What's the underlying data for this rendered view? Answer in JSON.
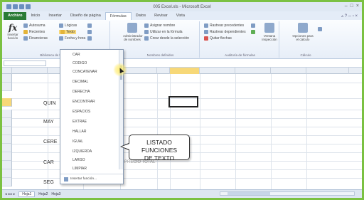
{
  "window": {
    "title": "005 Excel.xls - Microsoft Excel",
    "controls": [
      "–",
      "□",
      "×"
    ]
  },
  "ribbon": {
    "tabs": [
      "Archivo",
      "Inicio",
      "Insertar",
      "Diseño de página",
      "Fórmulas",
      "Datos",
      "Revisar",
      "Vista"
    ],
    "active_tab": "Fórmulas",
    "insert_function": "Insertar función",
    "library": {
      "autosum": "Autosuma",
      "recent": "Recientes",
      "financial": "Financieras",
      "logical": "Lógicas",
      "text": "Texto",
      "date_time": "Fecha y hora",
      "more": "Más funciones",
      "caption": "Biblioteca de funciones"
    },
    "names": {
      "manager": "Administrador de nombres",
      "define": "Asignar nombre",
      "use": "Utilizar en la fórmula",
      "create": "Crear desde la selección",
      "caption": "Nombres definidos"
    },
    "audit": {
      "trace_precedents": "Rastrear precedentes",
      "trace_dependents": "Rastrear dependientes",
      "remove_arrows": "Quitar flechas",
      "watch_window": "Ventana Inspección",
      "caption": "Auditoría de fórmulas"
    },
    "calc": {
      "options": "Opciones para el cálculo",
      "caption": "Cálculo"
    }
  },
  "dropdown": {
    "items": [
      "CAR",
      "CODIGO",
      "CONCATENAR",
      "DECIMAL",
      "DERECHA",
      "ENCONTRAR",
      "ESPACIOS",
      "EXTRAE",
      "HALLAR",
      "IGUAL",
      "IZQUIERDA",
      "LARGO",
      "LIMPIAR",
      "MAYUSC",
      "MINUSC",
      "MONEDA"
    ],
    "footer": "Insertar función..."
  },
  "sheet": {
    "cells": [
      "QUIN",
      "MAY",
      "CERE",
      "CAR",
      "SEG"
    ],
    "hidden_text": "PRECIO TOTAL"
  },
  "callout": {
    "line1": "LISTADO FUNCIONES",
    "line2": "DE TEXTO"
  },
  "sheetbar": {
    "tabs": [
      "Hoja1",
      "Hoja2",
      "Hoja3"
    ]
  }
}
